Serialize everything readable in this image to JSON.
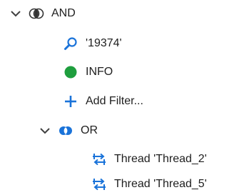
{
  "filter_tree": {
    "root": {
      "operator_label": "AND",
      "icon": "and-operator-icon",
      "expanded": true,
      "children": [
        {
          "type": "search",
          "icon": "search-icon",
          "label": "'19374'"
        },
        {
          "type": "level",
          "icon": "green-circle-icon",
          "label": "INFO",
          "color": "#1e9e3e"
        },
        {
          "type": "add",
          "icon": "plus-icon",
          "label": "Add Filter...",
          "color": "#1a73d9"
        },
        {
          "type": "group",
          "operator_label": "OR",
          "icon": "or-operator-icon",
          "expanded": true,
          "children": [
            {
              "type": "thread",
              "icon": "thread-icon",
              "label": "Thread 'Thread_2'"
            },
            {
              "type": "thread",
              "icon": "thread-icon",
              "label": "Thread 'Thread_5'"
            }
          ]
        }
      ]
    }
  },
  "colors": {
    "accent_blue": "#1a73d9",
    "info_green": "#1e9e3e",
    "text": "#1e1e1e",
    "chevron": "#404040"
  }
}
